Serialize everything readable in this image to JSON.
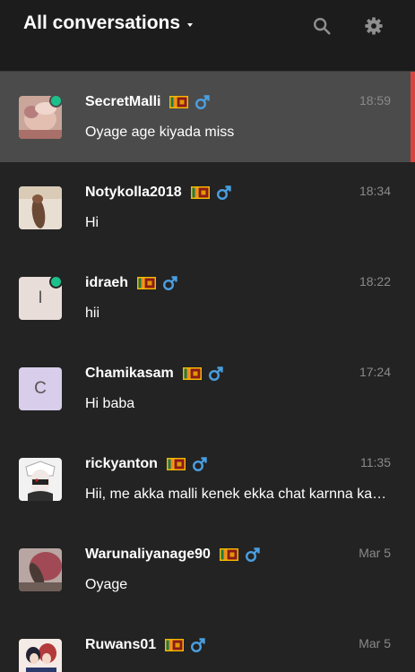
{
  "header": {
    "title": "All conversations"
  },
  "colors": {
    "online": "#1cc08a",
    "active_bar": "#d9443d",
    "male_icon": "#4a9fe0"
  },
  "conversations": [
    {
      "name": "SecretMalli",
      "time": "18:59",
      "preview": "Oyage age kiyada miss",
      "online": true,
      "active": true,
      "avatar": "photo-1",
      "avatar_letter": ""
    },
    {
      "name": "Notykolla2018",
      "time": "18:34",
      "preview": "Hi",
      "online": false,
      "active": false,
      "avatar": "photo-2",
      "avatar_letter": ""
    },
    {
      "name": "idraeh",
      "time": "18:22",
      "preview": "hii",
      "online": true,
      "active": false,
      "avatar": "letter",
      "avatar_letter": "I"
    },
    {
      "name": "Chamikasam",
      "time": "17:24",
      "preview": "Hi baba",
      "online": false,
      "active": false,
      "avatar": "letter",
      "avatar_letter": "C"
    },
    {
      "name": "rickyanton",
      "time": "11:35",
      "preview": "Hii, me akka malli kenek ekka chat karnna kamathi kenek innwad?",
      "online": false,
      "active": false,
      "avatar": "photo-3",
      "avatar_letter": ""
    },
    {
      "name": "Warunaliyanage90",
      "time": "Mar 5",
      "preview": "Oyage",
      "online": false,
      "active": false,
      "avatar": "photo-4",
      "avatar_letter": ""
    },
    {
      "name": "Ruwans01",
      "time": "Mar 5",
      "preview": "",
      "online": false,
      "active": false,
      "avatar": "photo-5",
      "avatar_letter": ""
    }
  ]
}
